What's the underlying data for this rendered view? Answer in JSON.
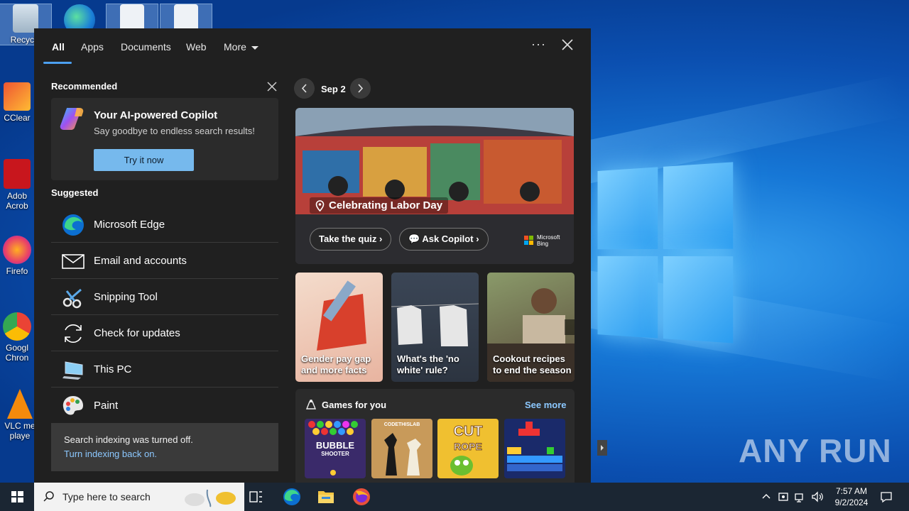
{
  "desktop": {
    "icons": [
      {
        "label": "Recycle"
      },
      {
        "label": ""
      },
      {
        "label": ""
      },
      {
        "label": ""
      },
      {
        "label": "CClear"
      },
      {
        "label": "Adob Acrob"
      },
      {
        "label": "Firefo"
      },
      {
        "label": "Googl Chron"
      },
      {
        "label": "VLC me playe"
      }
    ],
    "watermark": "ANY RUN"
  },
  "panel": {
    "tabs": [
      {
        "label": "All",
        "active": true
      },
      {
        "label": "Apps"
      },
      {
        "label": "Documents"
      },
      {
        "label": "Web"
      },
      {
        "label": "More"
      }
    ],
    "options_label": "···",
    "recommended": {
      "title": "Recommended",
      "card_title": "Your AI-powered Copilot",
      "card_subtitle": "Say goodbye to endless search results!",
      "button": "Try it now"
    },
    "suggested": {
      "title": "Suggested",
      "items": [
        {
          "label": "Microsoft Edge",
          "icon": "edge-icon"
        },
        {
          "label": "Email and accounts",
          "icon": "mail-icon"
        },
        {
          "label": "Snipping Tool",
          "icon": "scissors-icon"
        },
        {
          "label": "Check for updates",
          "icon": "refresh-icon"
        },
        {
          "label": "This PC",
          "icon": "computer-icon"
        },
        {
          "label": "Paint",
          "icon": "palette-icon"
        }
      ]
    },
    "indexing": {
      "text": "Search indexing was turned off.",
      "link": "Turn indexing back on."
    },
    "highlights": {
      "date": "Sep 2",
      "hero_title": "Celebrating Labor Day",
      "hero_buttons": [
        "Take the quiz",
        "Ask Copilot"
      ],
      "bing_label_1": "Microsoft",
      "bing_label_2": "Bing",
      "tiles": [
        {
          "line1": "Gender pay gap",
          "line2": "and more facts"
        },
        {
          "line1": "What's the 'no",
          "line2": "white' rule?"
        },
        {
          "line1": "Cookout recipes",
          "line2": "to end the season"
        }
      ]
    },
    "games": {
      "title": "Games for you",
      "see_more": "See more",
      "items": [
        {
          "line1": "BUBBLE",
          "line2": "SHOOTER"
        },
        {
          "line1": "CODETHISLAB",
          "line2": ""
        },
        {
          "line1": "CUT",
          "line2": "ROPE"
        },
        {
          "line1": "",
          "line2": ""
        }
      ]
    }
  },
  "taskbar": {
    "search_placeholder": "Type here to search",
    "time": "7:57 AM",
    "date": "9/2/2024"
  },
  "colors": {
    "panel_bg": "#202020",
    "accent": "#4ca0f0",
    "button_bg": "#76b9ed",
    "link": "#8cc8ff",
    "taskbar": "#1b2633"
  }
}
